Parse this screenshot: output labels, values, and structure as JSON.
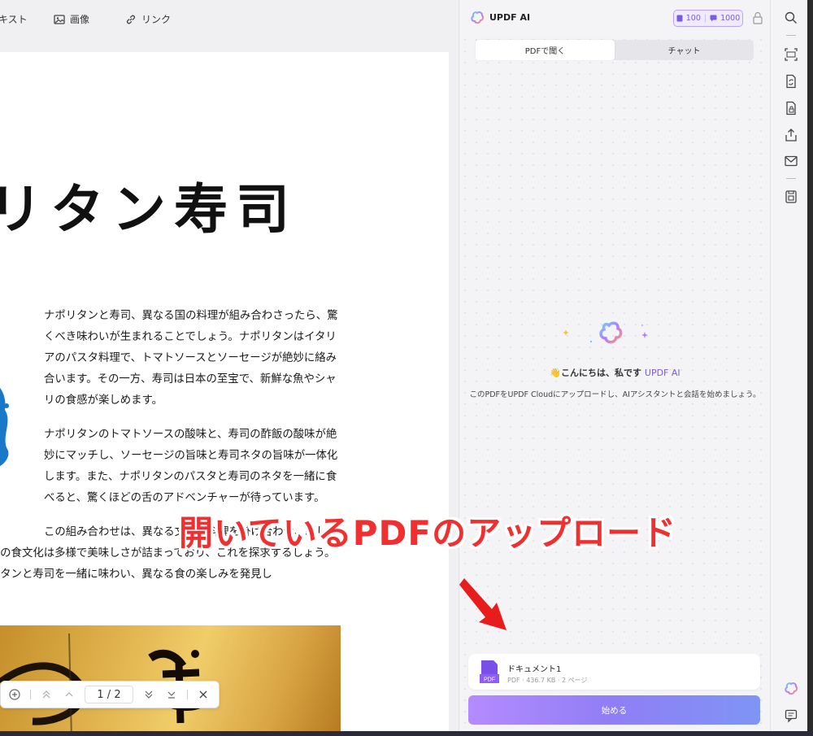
{
  "toolbar": {
    "text_label": "キスト",
    "image_label": "画像",
    "link_label": "リンク"
  },
  "document": {
    "title": "リタン寿司",
    "paragraph1": "ナポリタンと寿司、異なる国の料理が組み合わさったら、驚くべき味わいが生まれることでしょう。ナポリタンはイタリアのパスタ料理で、トマトソースとソーセージが絶妙に絡み合います。その一方、寿司は日本の至宝で、新鮮な魚やシャリの食感が楽しめます。",
    "paragraph2": "ナポリタンのトマトソースの酸味と、寿司の酢飯の酸味が絶妙にマッチし、ソーセージの旨味と寿司ネタの旨味が一体化します。また、ナポリタンのパスタと寿司のネタを一緒に食べると、驚くほどの舌のアドベンチャーが待っています。",
    "paragraph3": "この組み合わせは、異なる文化の料理を掛け合わせ、新しい世界中の食文化は多様で美味しさが詰まっており、これを探求するしょう。ナポリタンと寿司を一緒に味わい、異なる食の楽しみを発見し"
  },
  "pager": {
    "page_display": "1 / 2"
  },
  "annotation": {
    "text": "開いているPDFのアップロード"
  },
  "ai_panel": {
    "title": "UPDF AI",
    "credits_doc": "100",
    "credits_chat": "1000",
    "tabs": [
      {
        "label": "PDFで聞く",
        "active": true
      },
      {
        "label": "チャット",
        "active": false
      }
    ],
    "greeting_prefix": "こんにちは、私です",
    "greeting_brand": "UPDF AI",
    "subtitle": "このPDFをUPDF Cloudにアップロードし、AIアシスタントと会話を始めましょう。",
    "file": {
      "name": "ドキュメント1",
      "type_badge": "PDF",
      "meta": "PDF · 436.7 KB · 2 ページ"
    },
    "start_label": "始める"
  },
  "rail": {
    "icons": [
      "search-icon",
      "ocr-icon",
      "convert-icon",
      "protect-icon",
      "share-icon",
      "mail-icon",
      "save-icon",
      "updf-ai-icon",
      "comment-icon"
    ]
  },
  "colors": {
    "accent": "#7a5ae0",
    "annotation_red": "#f03030",
    "start_gradient_from": "#b48bff",
    "start_gradient_to": "#7f95f5"
  }
}
